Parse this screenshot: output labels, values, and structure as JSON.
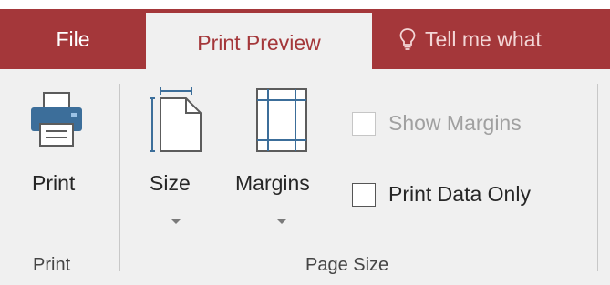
{
  "tabs": {
    "file_label": "File",
    "active_label": "Print Preview",
    "tell_me": "Tell me what"
  },
  "ribbon": {
    "print_group": {
      "print_button_label": "Print",
      "group_label": "Print"
    },
    "page_size_group": {
      "size_label": "Size",
      "margins_label": "Margins",
      "show_margins_label": "Show Margins",
      "show_margins_checked": false,
      "show_margins_enabled": false,
      "print_data_only_label": "Print Data Only",
      "print_data_only_checked": false,
      "group_label": "Page Size"
    }
  },
  "colors": {
    "accent": "#a4373a",
    "ribbon_bg": "#f0f0f0",
    "printer_icon": "#3c6e9a"
  },
  "icons": [
    "printer-icon",
    "page-size-icon",
    "margins-icon",
    "lightbulb-icon"
  ]
}
